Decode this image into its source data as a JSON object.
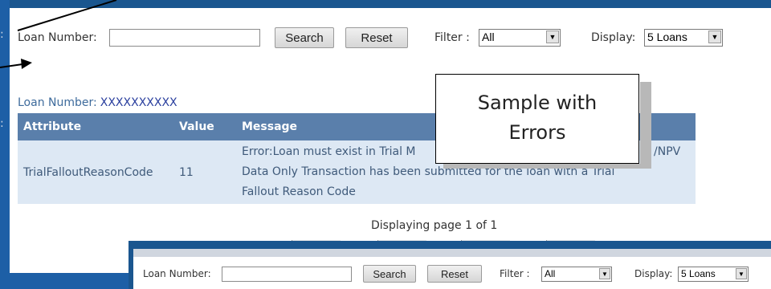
{
  "search": {
    "loan_number_label": "Loan Number:",
    "loan_number_value": "",
    "search_button": "Search",
    "reset_button": "Reset",
    "filter_label": "Filter :",
    "filter_value": "All",
    "display_label": "Display:",
    "display_value": "5 Loans"
  },
  "results": {
    "loan_number_label": "Loan Number:",
    "loan_number_value": "XXXXXXXXXX",
    "columns": [
      "Attribute",
      "Value",
      "Message"
    ],
    "rows": [
      {
        "attribute": "TrialFalloutReasonCode",
        "value": "11",
        "message_lines": [
          "Error:Loan must exist in Trial M",
          "Data Only Transaction has been submitted for the loan with a Trial",
          "Fallout Reason Code"
        ],
        "message_tail": "/NPV"
      }
    ],
    "pager": "Displaying page 1 of 1"
  },
  "callout": {
    "line1": "Sample with",
    "line2": "Errors"
  },
  "lower_search": {
    "loan_number_label": "Loan Number:",
    "search_button": "Search",
    "reset_button": "Reset",
    "filter_label": "Filter :",
    "filter_value": "All",
    "display_label": "Display:",
    "display_value": "5 Loans"
  },
  "colors": {
    "background_blue": "#1d5fa6",
    "table_header": "#5a7fab",
    "table_row": "#dde8f4"
  }
}
